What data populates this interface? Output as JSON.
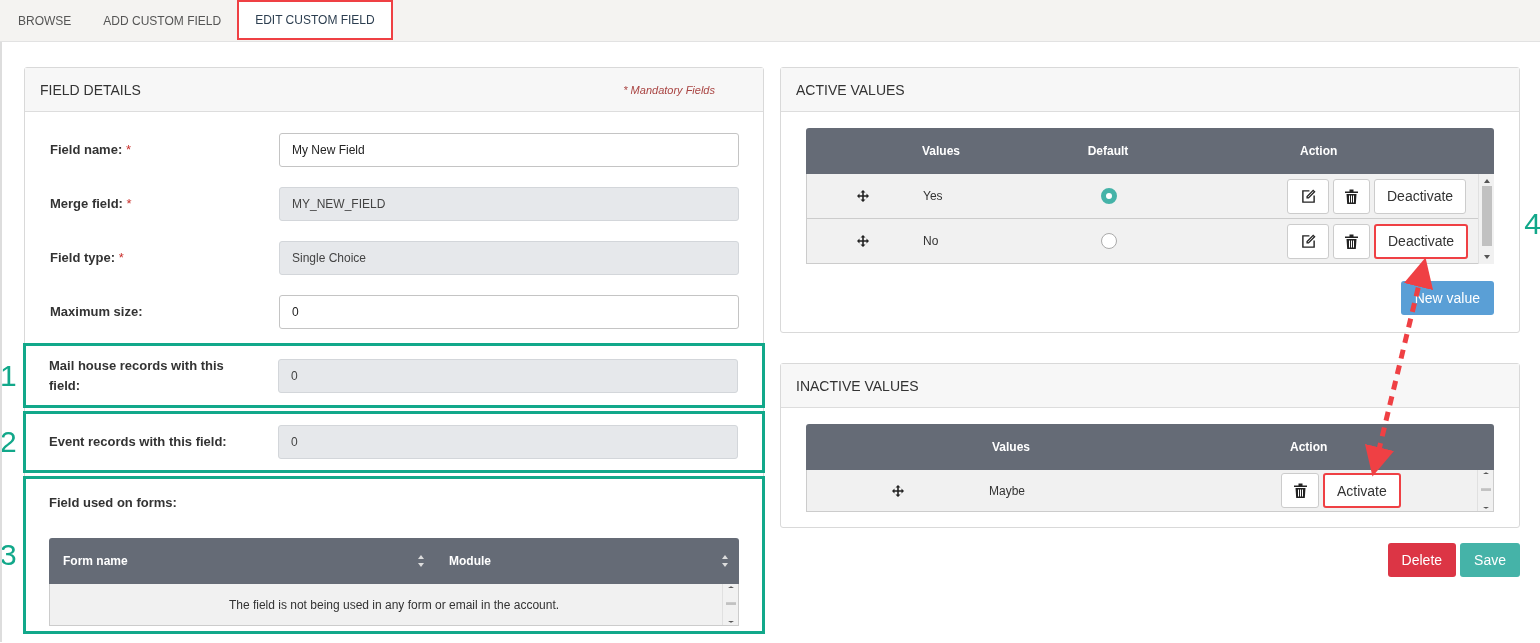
{
  "tabs": [
    {
      "label": "BROWSE",
      "selected": false,
      "highlighted": false
    },
    {
      "label": "ADD CUSTOM FIELD",
      "selected": false,
      "highlighted": false
    },
    {
      "label": "EDIT CUSTOM FIELD",
      "selected": true,
      "highlighted": true
    }
  ],
  "field_details": {
    "title": "FIELD DETAILS",
    "mandatory_note": "* Mandatory Fields",
    "fields": [
      {
        "label": "Field name:",
        "required_mark": "*",
        "value": "My New Field",
        "readonly": false
      },
      {
        "label": "Merge field:",
        "required_mark": "*",
        "value": "MY_NEW_FIELD",
        "readonly": true
      },
      {
        "label": "Field type:",
        "required_mark": "*",
        "value": "Single Choice",
        "readonly": true
      },
      {
        "label": "Maximum size:",
        "value": "0",
        "readonly": false
      },
      {
        "label": "Mail house records with this field:",
        "value": "0",
        "readonly": true,
        "callout": "1"
      },
      {
        "label": "Event records with this field:",
        "value": "0",
        "readonly": true,
        "callout": "2"
      }
    ],
    "forms_section": {
      "label": "Field used on forms:",
      "callout": "3",
      "columns": [
        "Form name",
        "Module"
      ],
      "empty_message": "The field is not being used in any form or email in the account."
    }
  },
  "active_values": {
    "title": "ACTIVE VALUES",
    "columns": [
      "Values",
      "Default",
      "Action"
    ],
    "callout": "4",
    "rows": [
      {
        "value": "Yes",
        "default": true,
        "action": "Deactivate",
        "highlighted": false
      },
      {
        "value": "No",
        "default": false,
        "action": "Deactivate",
        "highlighted": true
      }
    ],
    "new_value_button": "New value"
  },
  "inactive_values": {
    "title": "INACTIVE VALUES",
    "columns": [
      "Values",
      "Action"
    ],
    "rows": [
      {
        "value": "Maybe",
        "action": "Activate",
        "highlighted": true
      }
    ]
  },
  "buttons": [
    {
      "label": "Delete",
      "kind": "danger"
    },
    {
      "label": "Save",
      "kind": "primary"
    }
  ]
}
